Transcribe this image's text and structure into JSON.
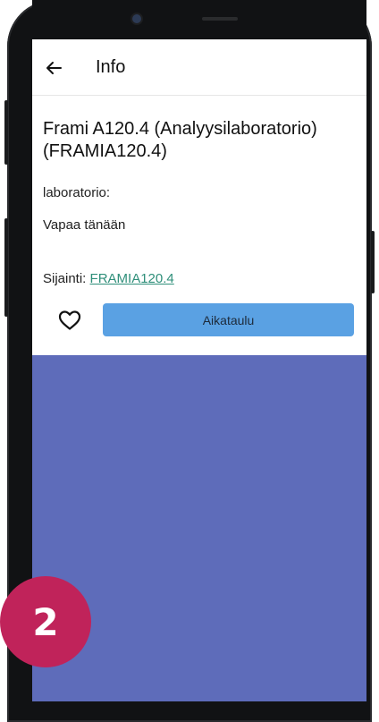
{
  "appbar": {
    "title": "Info",
    "back_icon": "arrow-left-icon"
  },
  "details": {
    "title": "Frami A120.4 (Analyysilaboratorio) (FRAMIA120.4)",
    "type_label": "laboratorio:",
    "availability": "Vapaa tänään",
    "location_label": "Sijainti: ",
    "location_link": "FRAMIA120.4"
  },
  "actions": {
    "favorite_icon": "heart-outline-icon",
    "schedule_label": "Aikataulu"
  },
  "badge": {
    "number": "2"
  },
  "colors": {
    "background": "#5e6cba",
    "button": "#5aa1e3",
    "link": "#2f8f7a",
    "badge": "#c0235a"
  }
}
